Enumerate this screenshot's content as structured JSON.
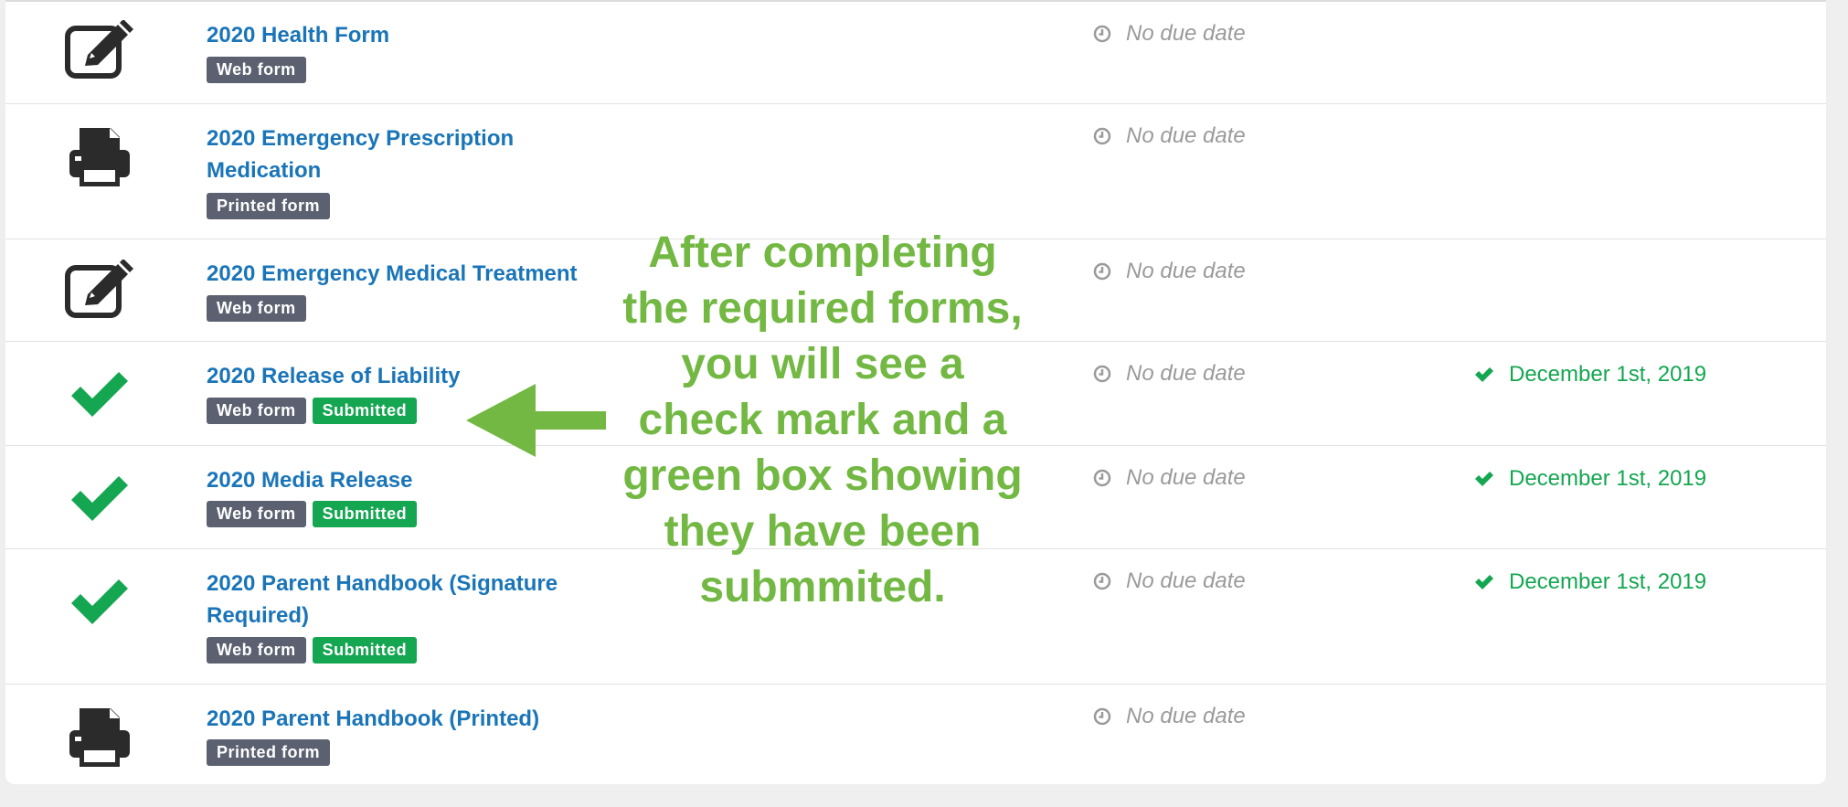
{
  "forms": [
    {
      "title": "2020 Health Form",
      "type_badge": "Web form",
      "status_badge": "",
      "due": "No due date",
      "submitted_date": "",
      "icon": "edit-form-icon"
    },
    {
      "title": "2020 Emergency Prescription Medication",
      "type_badge": "Printed form",
      "status_badge": "",
      "due": "No due date",
      "submitted_date": "",
      "icon": "printer-icon"
    },
    {
      "title": "2020 Emergency Medical Treatment",
      "type_badge": "Web form",
      "status_badge": "",
      "due": "No due date",
      "submitted_date": "",
      "icon": "edit-form-icon"
    },
    {
      "title": "2020 Release of Liability",
      "type_badge": "Web form",
      "status_badge": "Submitted",
      "due": "No due date",
      "submitted_date": "December 1st, 2019",
      "icon": "checkmark-icon"
    },
    {
      "title": "2020 Media Release",
      "type_badge": "Web form",
      "status_badge": "Submitted",
      "due": "No due date",
      "submitted_date": "December 1st, 2019",
      "icon": "checkmark-icon"
    },
    {
      "title": "2020 Parent Handbook (Signature Required)",
      "type_badge": "Web form",
      "status_badge": "Submitted",
      "due": "No due date",
      "submitted_date": "December 1st, 2019",
      "icon": "checkmark-icon"
    },
    {
      "title": "2020 Parent Handbook (Printed)",
      "type_badge": "Printed form",
      "status_badge": "",
      "due": "No due date",
      "submitted_date": "",
      "icon": "printer-icon"
    }
  ],
  "annotation": {
    "text": "After completing\nthe required forms,\nyou will see a\ncheck mark and a\ngreen box showing\nthey have been\nsubmmited."
  },
  "colors": {
    "link": "#1a75b8",
    "type_badge": "#5b6170",
    "submitted_badge": "#14a651",
    "annotation": "#72b843",
    "muted": "#9a9a9a"
  }
}
